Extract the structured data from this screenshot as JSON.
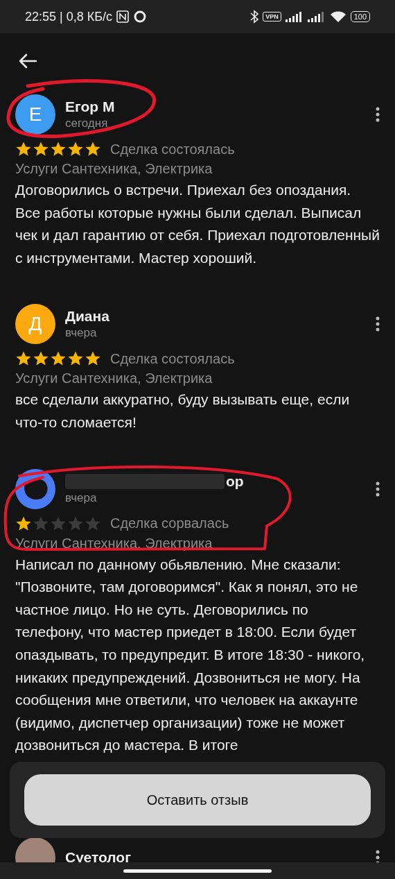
{
  "status_bar": {
    "time_speed": "22:55 | 0,8 КБ/с",
    "vpn": "VPN",
    "battery": "100"
  },
  "reviews": [
    {
      "avatar": {
        "letter": "Е",
        "color": "#3d9bf0",
        "covered": false
      },
      "name": "Егор М",
      "name_redacted": false,
      "date": "сегодня",
      "stars": 5,
      "deal": "Сделка состоялась",
      "services": "Услуги Сантехника, Электрика",
      "text": "Договорились о встречи. Приехал без опоздания. Все работы которые нужны были сделал. Выписал чек и дал гарантию от себя. Приехал подготовленный с инструментами. Мастер хороший."
    },
    {
      "avatar": {
        "letter": "Д",
        "color": "#fca90f",
        "covered": false
      },
      "name": "Диана",
      "name_redacted": false,
      "date": "вчера",
      "stars": 5,
      "deal": "Сделка состоялась",
      "services": "Услуги Сантехника, Электрика",
      "text": "все сделали аккуратно, буду вызывать еще, если что-то сломается!"
    },
    {
      "avatar": {
        "color": "#4a7cf5",
        "covered": true
      },
      "name": "ор",
      "name_redacted": true,
      "date": "вчера",
      "stars": 1,
      "deal": "Сделка сорвалась",
      "services": "Услуги Сантехника, Электрика",
      "text": "Написал по данному обьявлению. Мне сказали: \"Позвоните, там договоримся\". Как я понял, это не частное лицо. Но не суть. Деговорились по телефону, что мастер приедет в 18:00. Если будет опаздывать, то предупредит. В итоге 18:30 - никого, никаких предупреждений. Дозвониться не могу. На сообщения мне ответили, что человек на аккаунте (видимо, диспетчер организации) тоже не может дозвониться до мастера. В итоге"
    },
    {
      "avatar": {
        "color": "#a08478",
        "covered": false
      },
      "name": "Суетолог",
      "name_redacted": false
    }
  ],
  "action_button": "Оставить отзыв"
}
